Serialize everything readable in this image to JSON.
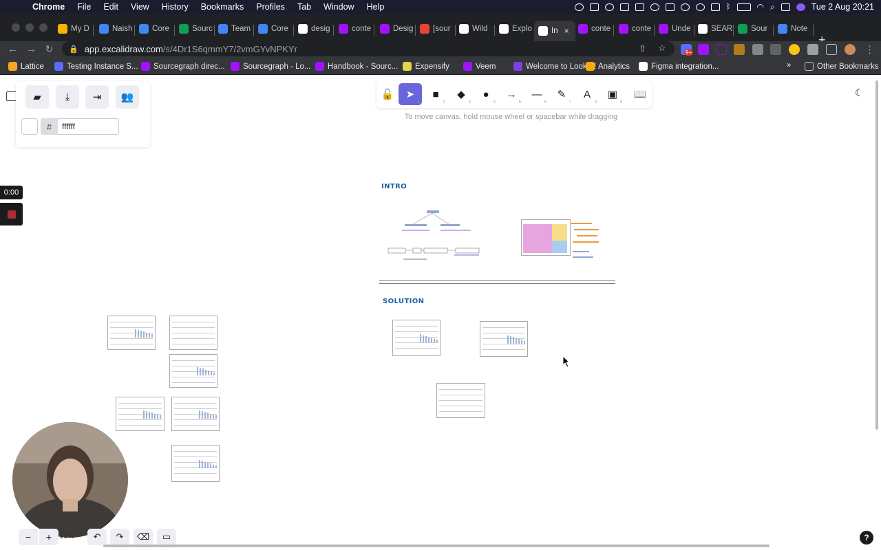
{
  "menubar": {
    "items": [
      "Chrome",
      "File",
      "Edit",
      "View",
      "History",
      "Bookmarks",
      "Profiles",
      "Tab",
      "Window",
      "Help"
    ],
    "badge": "9+",
    "datetime": "Tue 2 Aug  20:21"
  },
  "tabs": [
    {
      "label": "My D",
      "icon": "drive-icon",
      "color": "#f4b400"
    },
    {
      "label": "Naish",
      "icon": "docs-icon",
      "color": "#4285f4"
    },
    {
      "label": "Core",
      "icon": "docs-icon",
      "color": "#4285f4"
    },
    {
      "label": "Sourc",
      "icon": "sheets-icon",
      "color": "#0f9d58"
    },
    {
      "label": "Team",
      "icon": "docs-icon",
      "color": "#4285f4"
    },
    {
      "label": "Core",
      "icon": "docs-icon",
      "color": "#4285f4"
    },
    {
      "label": "desig",
      "icon": "google-icon",
      "color": "#ffffff"
    },
    {
      "label": "conte",
      "icon": "sourcegraph-icon",
      "color": "#a112ff"
    },
    {
      "label": "Desig",
      "icon": "sourcegraph-icon",
      "color": "#a112ff"
    },
    {
      "label": "[sour",
      "icon": "gmail-icon",
      "color": "#ea4335"
    },
    {
      "label": "Wild",
      "icon": "github-icon",
      "color": "#ffffff"
    },
    {
      "label": "Explo",
      "icon": "excalidraw-icon",
      "color": "#ffffff"
    },
    {
      "label": "In",
      "icon": "excalidraw-icon",
      "color": "#ffffff",
      "active": true
    },
    {
      "label": "conte",
      "icon": "sourcegraph-icon",
      "color": "#a112ff"
    },
    {
      "label": "conte",
      "icon": "sourcegraph-icon",
      "color": "#a112ff"
    },
    {
      "label": "Unde",
      "icon": "sourcegraph-icon",
      "color": "#a112ff"
    },
    {
      "label": "SEAR",
      "icon": "google-icon",
      "color": "#ffffff"
    },
    {
      "label": "Sour",
      "icon": "sheets-icon",
      "color": "#0f9d58"
    },
    {
      "label": "Note",
      "icon": "docs-icon",
      "color": "#4285f4"
    }
  ],
  "url": {
    "host": "app.excalidraw.com",
    "path": "/s/4Dr1S6qmmY7/2vmGYvNPKYr"
  },
  "bookmarks": [
    {
      "label": "Lattice",
      "color": "#f5a623"
    },
    {
      "label": "Testing Instance S...",
      "color": "#5b6cff"
    },
    {
      "label": "Sourcegraph direc...",
      "color": "#a112ff"
    },
    {
      "label": "Sourcegraph - Lo...",
      "color": "#a112ff"
    },
    {
      "label": "Handbook - Sourc...",
      "color": "#a112ff"
    },
    {
      "label": "Expensify",
      "color": "#e6d34a"
    },
    {
      "label": "Veem",
      "color": "#a112ff"
    },
    {
      "label": "Welcome to Looker!",
      "color": "#7b3fe4"
    },
    {
      "label": "Analytics",
      "color": "#f9ab00"
    },
    {
      "label": "Figma integration...",
      "color": "#ffffff"
    }
  ],
  "bookmarks_overflow": "»",
  "other_bookmarks": "Other Bookmarks",
  "excalidraw": {
    "hex_value": "ffffff",
    "hash": "#",
    "hint": "To move canvas, hold mouse wheel or spacebar while dragging",
    "zoom": "10%",
    "timer": "0:00",
    "tools": [
      {
        "name": "lock",
        "glyph": "🔓",
        "key": ""
      },
      {
        "name": "selection",
        "glyph": "➤",
        "key": "1"
      },
      {
        "name": "rectangle",
        "glyph": "■",
        "key": "2"
      },
      {
        "name": "diamond",
        "glyph": "◆",
        "key": "3"
      },
      {
        "name": "ellipse",
        "glyph": "●",
        "key": "4"
      },
      {
        "name": "arrow",
        "glyph": "→",
        "key": "5"
      },
      {
        "name": "line",
        "glyph": "—",
        "key": "6"
      },
      {
        "name": "draw",
        "glyph": "✎",
        "key": "7"
      },
      {
        "name": "text",
        "glyph": "A",
        "key": "8"
      },
      {
        "name": "image",
        "glyph": "▣",
        "key": "9"
      },
      {
        "name": "library",
        "glyph": "📖",
        "key": ""
      }
    ]
  },
  "canvas": {
    "intro_heading": "INTRO",
    "solution_heading": "SOLUTION",
    "colors": {
      "heading": "#1f5fa8",
      "pink": "#e7a5e0",
      "yellow": "#f6dd8a",
      "blue": "#a9cdee"
    }
  }
}
